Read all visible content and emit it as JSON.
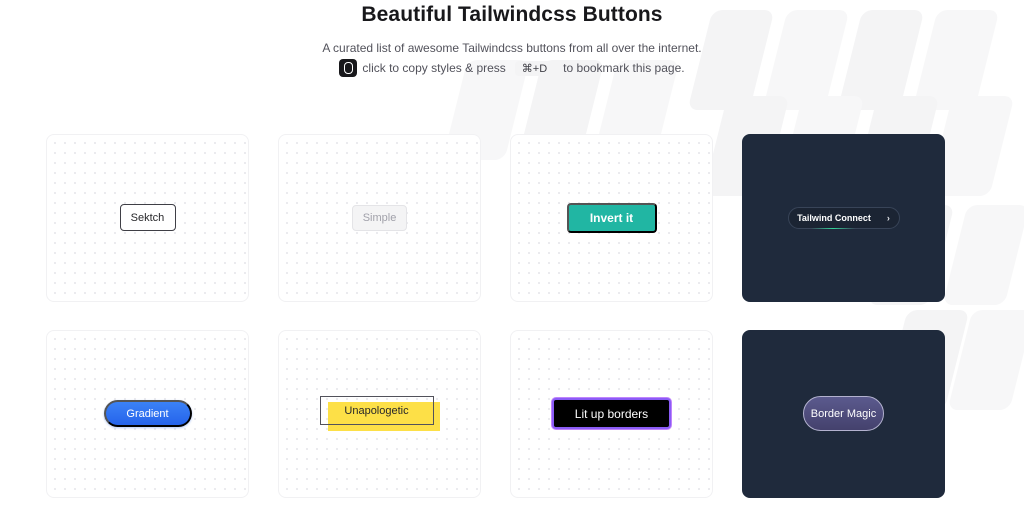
{
  "header": {
    "title": "Beautiful Tailwindcss Buttons",
    "subtitle": "A curated list of awesome Tailwindcss buttons from all over the internet.",
    "hint_click": "click to copy styles & press",
    "hint_shortcut": "⌘+D",
    "hint_bookmark": "to bookmark this page."
  },
  "buttons": {
    "sketch": "Sektch",
    "simple": "Simple",
    "invert": "Invert it",
    "tailwind_connect": "Tailwind Connect",
    "gradient": "Gradient",
    "unapologetic": "Unapologetic",
    "lit_up_borders": "Lit up borders",
    "border_magic": "Border Magic"
  },
  "icons": {
    "hint": "button-icon",
    "connect_arrow": "chevron-right-icon"
  },
  "colors": {
    "dark_card": "#1f2a3c",
    "invert_teal": "#21b6a3",
    "gradient_blue": "#2563eb",
    "unapologetic_yellow": "#fde047",
    "lit_up_purple": "#8b5cf6",
    "border_magic_violet": "#4f4d7e"
  }
}
